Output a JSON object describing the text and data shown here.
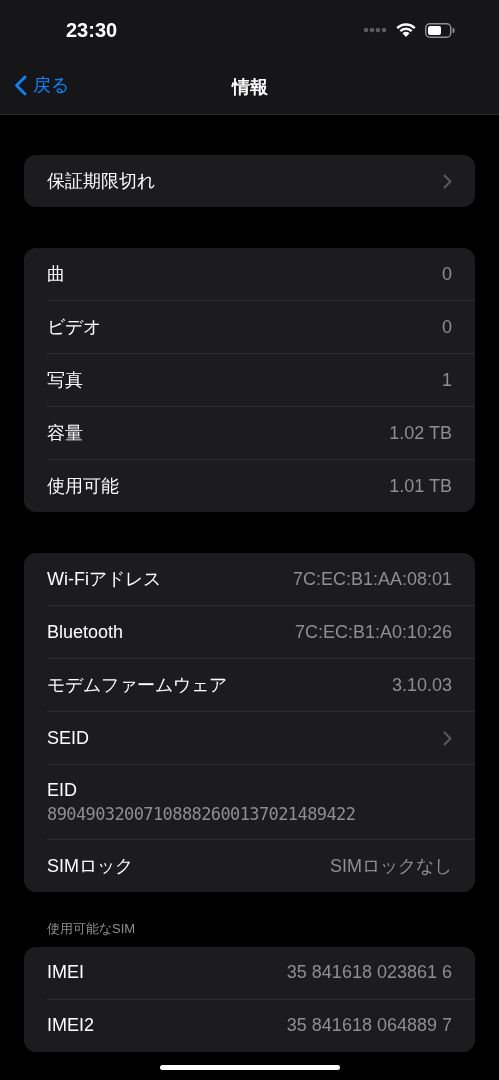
{
  "status_bar": {
    "time": "23:30"
  },
  "nav": {
    "back_label": "戻る",
    "title": "情報"
  },
  "groups": [
    {
      "rows": [
        {
          "kind": "chevron",
          "label": "保証期限切れ"
        }
      ]
    },
    {
      "rows": [
        {
          "kind": "value",
          "label": "曲",
          "value": "0"
        },
        {
          "kind": "value",
          "label": "ビデオ",
          "value": "0"
        },
        {
          "kind": "value",
          "label": "写真",
          "value": "1"
        },
        {
          "kind": "value",
          "label": "容量",
          "value": "1.02 TB"
        },
        {
          "kind": "value",
          "label": "使用可能",
          "value": "1.01 TB"
        }
      ]
    },
    {
      "rows": [
        {
          "kind": "value",
          "label": "Wi-Fiアドレス",
          "value": "7C:EC:B1:AA:08:01"
        },
        {
          "kind": "value",
          "label": "Bluetooth",
          "value": "7C:EC:B1:A0:10:26"
        },
        {
          "kind": "value",
          "label": "モデムファームウェア",
          "value": "3.10.03"
        },
        {
          "kind": "chevron",
          "label": "SEID"
        },
        {
          "kind": "stacked",
          "label": "EID",
          "value": "89049032007108882600137021489422"
        },
        {
          "kind": "value",
          "label": "SIMロック",
          "value": "SIMロックなし"
        }
      ]
    },
    {
      "header": "使用可能なSIM",
      "rows": [
        {
          "kind": "value",
          "label": "IMEI",
          "value": "35 841618 023861 6"
        },
        {
          "kind": "value",
          "label": "IMEI2",
          "value": "35 841618 064889 7"
        }
      ]
    }
  ]
}
